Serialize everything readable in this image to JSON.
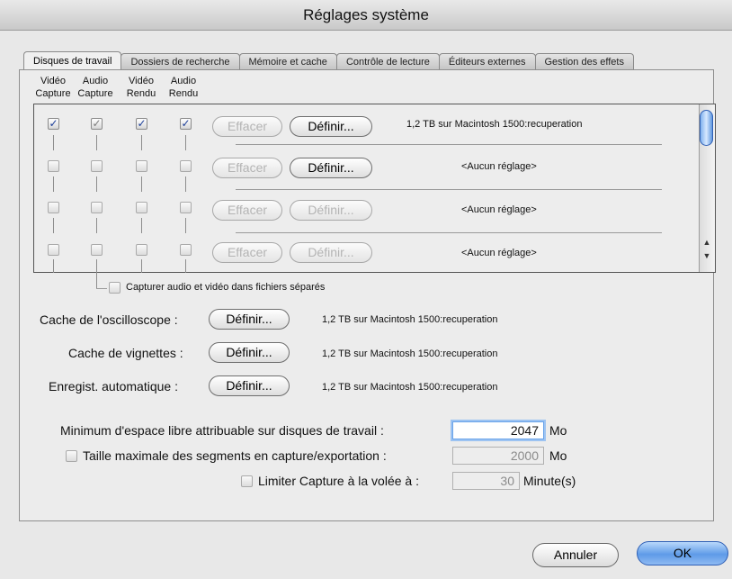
{
  "window": {
    "title": "Réglages système"
  },
  "tabs": [
    {
      "label": "Disques de travail",
      "active": true
    },
    {
      "label": "Dossiers de recherche",
      "active": false
    },
    {
      "label": "Mémoire et cache",
      "active": false
    },
    {
      "label": "Contrôle de lecture",
      "active": false
    },
    {
      "label": "Éditeurs externes",
      "active": false
    },
    {
      "label": "Gestion des effets",
      "active": false
    }
  ],
  "columns": [
    {
      "line1": "Vidéo",
      "line2": "Capture"
    },
    {
      "line1": "Audio",
      "line2": "Capture"
    },
    {
      "line1": "Vidéo",
      "line2": "Rendu"
    },
    {
      "line1": "Audio",
      "line2": "Rendu"
    }
  ],
  "scratch_rows": [
    {
      "checks": [
        "on",
        "dim",
        "on",
        "on"
      ],
      "clear_label": "Effacer",
      "clear_enabled": false,
      "set_label": "Définir...",
      "set_enabled": true,
      "path": "1,2 TB sur  Macintosh 1500:recuperation"
    },
    {
      "checks": [
        "off",
        "off",
        "off",
        "off"
      ],
      "clear_label": "Effacer",
      "clear_enabled": false,
      "set_label": "Définir...",
      "set_enabled": true,
      "path": "<Aucun réglage>"
    },
    {
      "checks": [
        "off",
        "off",
        "off",
        "off"
      ],
      "clear_label": "Effacer",
      "clear_enabled": false,
      "set_label": "Définir...",
      "set_enabled": false,
      "path": "<Aucun réglage>"
    },
    {
      "checks": [
        "off",
        "off",
        "off",
        "off"
      ],
      "clear_label": "Effacer",
      "clear_enabled": false,
      "set_label": "Définir...",
      "set_enabled": false,
      "path": "<Aucun réglage>"
    }
  ],
  "separate_files": {
    "label": "Capturer audio et vidéo dans fichiers séparés",
    "checked": false
  },
  "caches": [
    {
      "label": "Cache de l'oscilloscope :",
      "button": "Définir...",
      "path": "1,2 TB sur  Macintosh 1500:recuperation"
    },
    {
      "label": "Cache de vignettes :",
      "button": "Définir...",
      "path": "1,2 TB sur  Macintosh 1500:recuperation"
    },
    {
      "label": "Enregist. automatique :",
      "button": "Définir...",
      "path": "1,2 TB sur  Macintosh 1500:recuperation"
    }
  ],
  "min_free": {
    "label": "Minimum d'espace libre attribuable sur disques de travail :",
    "value": "2047",
    "unit": "Mo"
  },
  "max_segment": {
    "label": "Taille maximale des segments en capture/exportation :",
    "value": "2000",
    "unit": "Mo",
    "checked": false
  },
  "limit_capture": {
    "label": "Limiter Capture à la volée à :",
    "value": "30",
    "unit": "Minute(s)",
    "checked": false
  },
  "footer": {
    "cancel_label": "Annuler",
    "ok_label": "OK"
  },
  "colors": {
    "accent_blue": "#6aa3ea",
    "check_blue": "#1d3f9a"
  }
}
